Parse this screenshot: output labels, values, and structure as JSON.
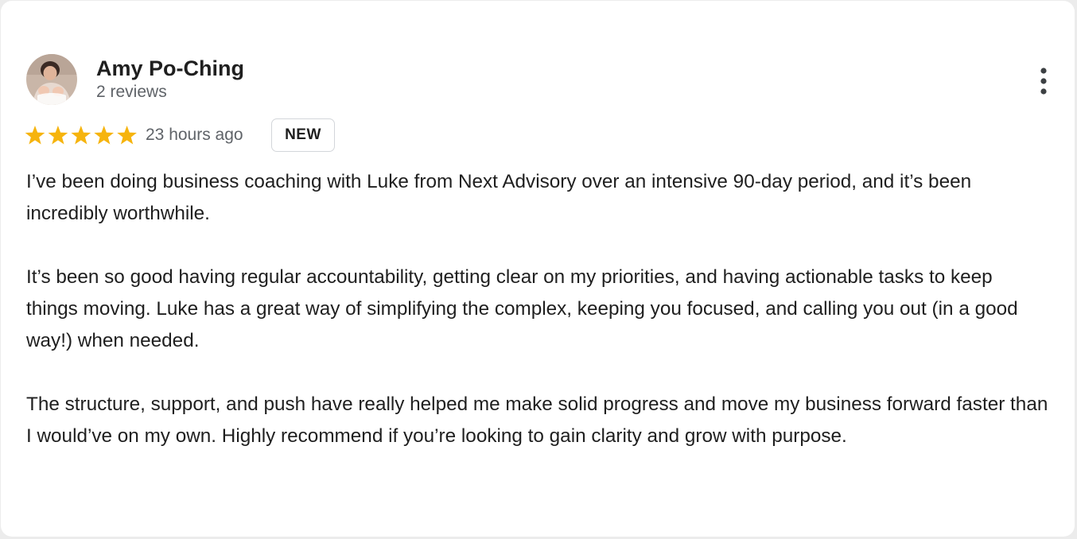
{
  "review": {
    "author": {
      "name": "Amy Po-Ching",
      "review_count": "2 reviews",
      "avatar": "profile-photo"
    },
    "rating": 5,
    "rating_max": 5,
    "time": "23 hours ago",
    "badge": "NEW",
    "paragraphs": [
      "I’ve been doing business coaching with Luke from Next Advisory over an intensive 90-day period, and it’s been incredibly worthwhile.",
      "It’s been so good having regular accountability, getting clear on my priorities, and having actionable tasks to keep things moving. Luke has a great way of simplifying the complex, keeping you focused, and calling you out (in a good way!) when needed.",
      "The structure, support, and push have really helped me make solid progress and move my business forward faster than I would’ve on my own. Highly recommend if you’re looking to gain clarity and grow with purpose."
    ]
  },
  "icons": {
    "star": "star-icon",
    "more": "more-vert-icon"
  },
  "colors": {
    "star": "#f6b40e",
    "text": "#1f1f1f",
    "muted": "#5f6368",
    "badge_border": "#d3d6da"
  }
}
